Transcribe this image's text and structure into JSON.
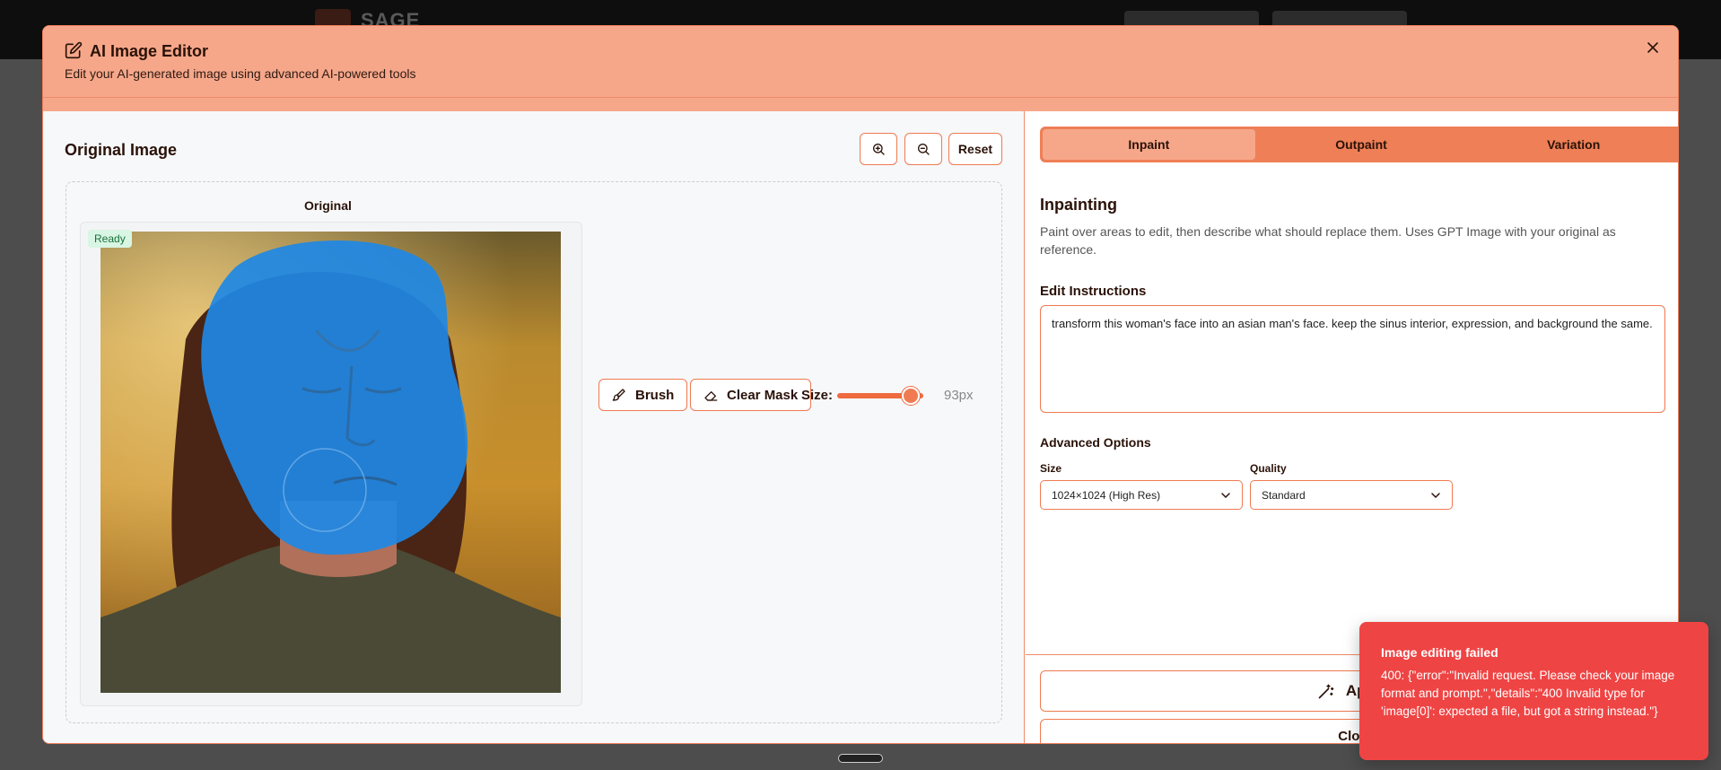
{
  "background": {
    "logo_text": "SAGE"
  },
  "modal": {
    "title": "AI Image Editor",
    "subtitle": "Edit your AI-generated image using advanced AI-powered tools",
    "close_icon": "x-icon"
  },
  "left": {
    "title": "Original Image",
    "zoom_in_icon": "zoom-in-icon",
    "zoom_out_icon": "zoom-out-icon",
    "reset_label": "Reset",
    "canvas_label": "Original",
    "status_badge": "Ready",
    "brush_label": "Brush",
    "clear_mask_label": "Clear Mask",
    "size_label": "Size:",
    "brush_size_value": "93px",
    "brush_size_fraction": 0.85
  },
  "right": {
    "tabs": [
      {
        "label": "Inpaint",
        "active": true
      },
      {
        "label": "Outpaint",
        "active": false
      },
      {
        "label": "Variation",
        "active": false
      }
    ],
    "section_title": "Inpainting",
    "section_desc": "Paint over areas to edit, then describe what should replace them. Uses GPT Image with your original as reference.",
    "instructions_label": "Edit Instructions",
    "instructions_value": "transform this woman's face into an asian man's face. keep the sinus interior, expression, and background the same.",
    "advanced_label": "Advanced Options",
    "size_field_label": "Size",
    "size_value": "1024×1024 (High Res)",
    "quality_field_label": "Quality",
    "quality_value": "Standard",
    "apply_label": "Apply",
    "close_label": "Clos"
  },
  "toast": {
    "title": "Image editing failed",
    "message": "400: {\"error\":\"Invalid request. Please check your image format and prompt.\",\"details\":\"400 Invalid type for 'image[0]': expected a file, but got a string instead.\"}"
  },
  "colors": {
    "accent": "#ef7a50",
    "header_bg": "#f6a78a",
    "tab_bar": "#ee7f56",
    "mask": "#1e88e5",
    "error": "#ef4444"
  }
}
